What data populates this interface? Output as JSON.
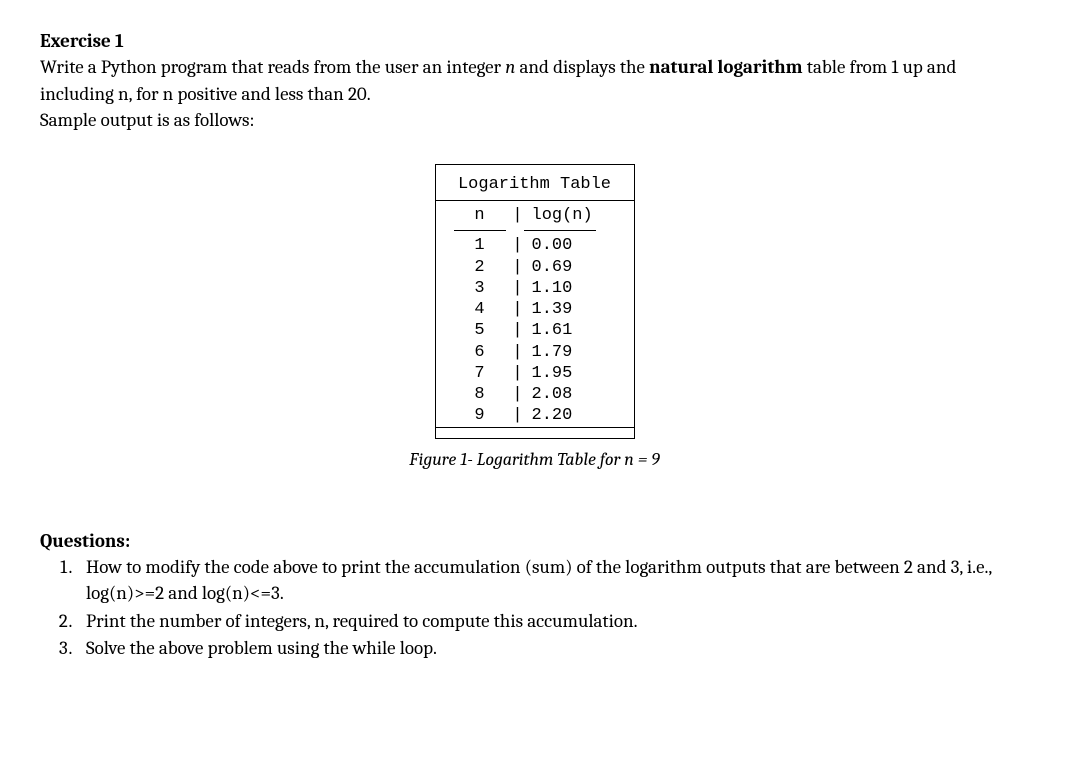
{
  "exercise_title": "Exercise 1",
  "intro": {
    "part1": "Write a Python program that reads from the user an integer ",
    "n_var": "n",
    "part2": " and displays the ",
    "bold_term": "natural logarithm",
    "part3": " table from 1 up and including n, for n positive and less than 20.",
    "part4": "Sample output is as follows:"
  },
  "table": {
    "title": "Logarithm Table",
    "header_n": "n",
    "header_log": "log(n)",
    "sep": "|"
  },
  "chart_data": {
    "type": "table",
    "columns": [
      "n",
      "log(n)"
    ],
    "rows": [
      {
        "n": "1",
        "logn": "0.00"
      },
      {
        "n": "2",
        "logn": "0.69"
      },
      {
        "n": "3",
        "logn": "1.10"
      },
      {
        "n": "4",
        "logn": "1.39"
      },
      {
        "n": "5",
        "logn": "1.61"
      },
      {
        "n": "6",
        "logn": "1.79"
      },
      {
        "n": "7",
        "logn": "1.95"
      },
      {
        "n": "8",
        "logn": "2.08"
      },
      {
        "n": "9",
        "logn": "2.20"
      }
    ]
  },
  "figure_caption": "Figure 1- Logarithm Table for n = 9",
  "questions_title": "Questions:",
  "questions": [
    "How to modify the code above to print the accumulation (sum) of the logarithm outputs that are between 2 and 3, i.e., log(n)>=2 and log(n)<=3.",
    "Print the number of integers, n, required to compute this accumulation.",
    "Solve the above problem using the while loop."
  ]
}
